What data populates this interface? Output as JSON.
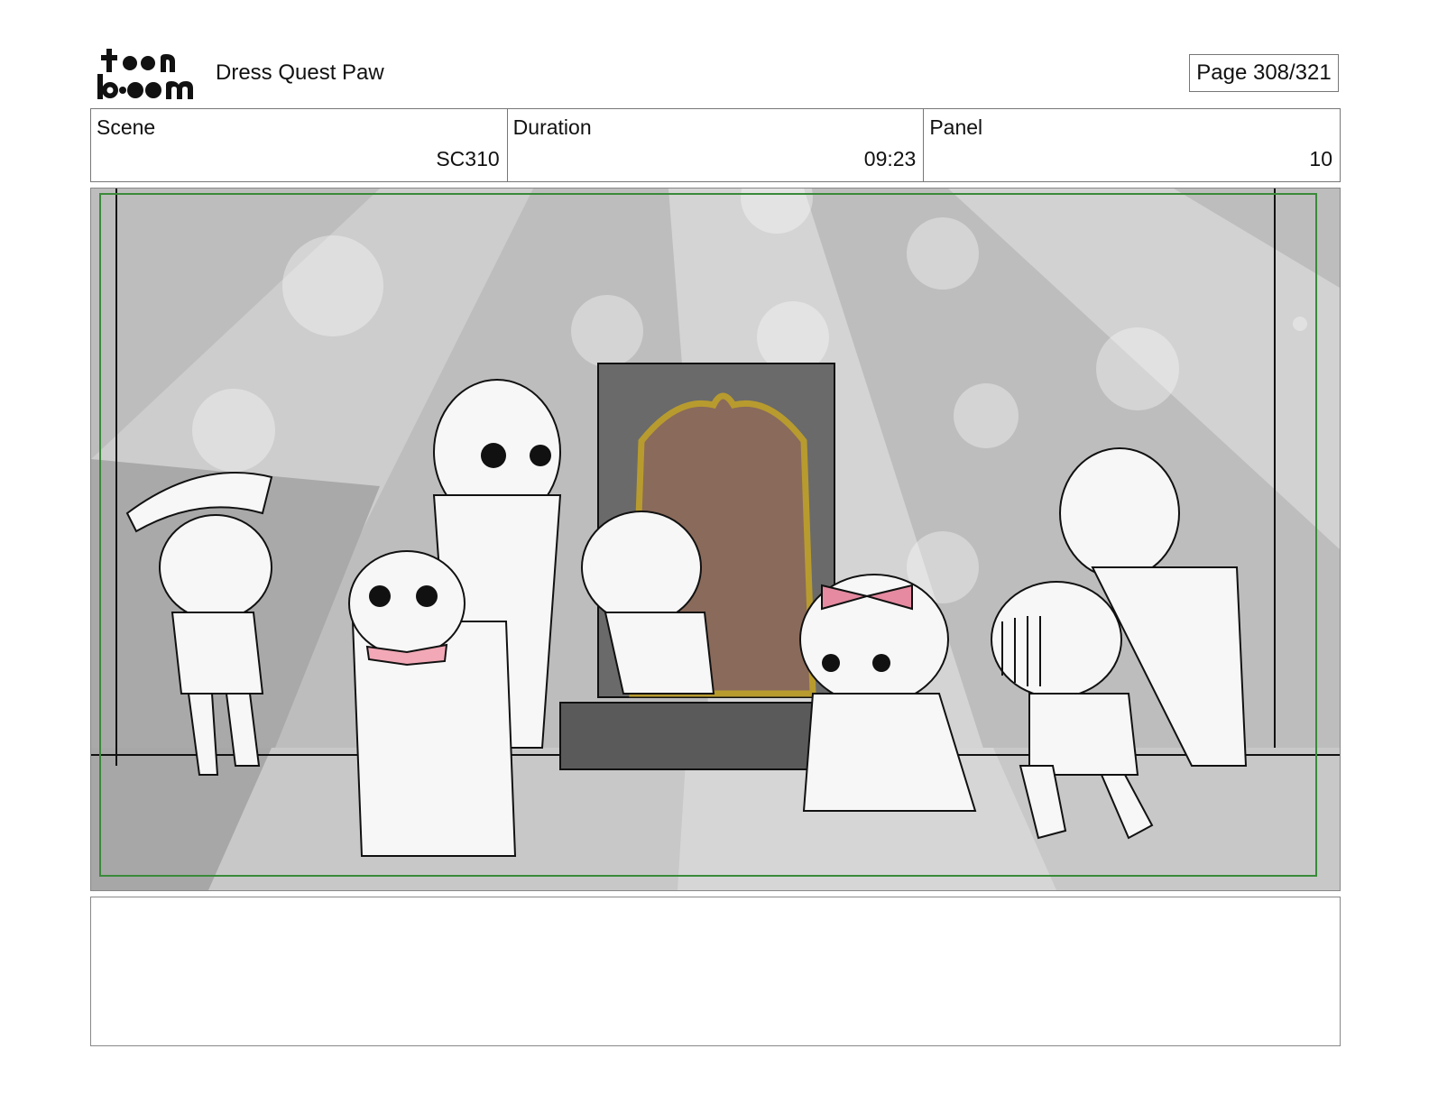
{
  "header": {
    "logo_text": "toon boom",
    "project_title": "Dress Quest Paw",
    "page_label": "Page 308/321"
  },
  "info": {
    "scene_label": "Scene",
    "scene_value": "SC310",
    "duration_label": "Duration",
    "duration_value": "09:23",
    "panel_label": "Panel",
    "panel_value": "10"
  },
  "panel_image": {
    "description_icon": "storyboard-drawing",
    "safe_area_color": "#3a8a3a"
  },
  "notes": {
    "text": ""
  }
}
